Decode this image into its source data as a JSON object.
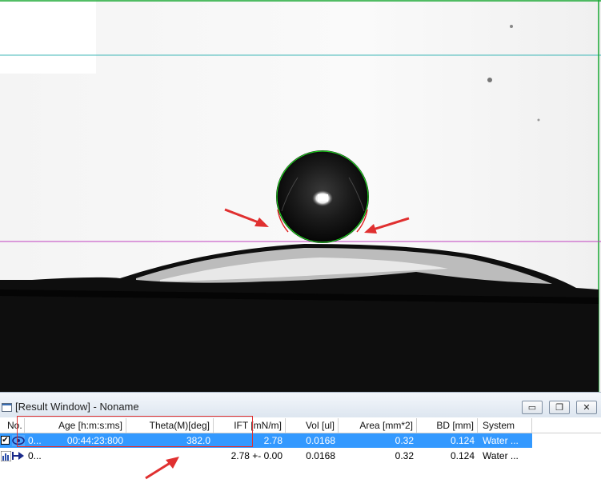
{
  "window": {
    "title": "[Result Window] - Noname",
    "minimize_label": "▭",
    "restore_label": "❐",
    "close_label": "✕"
  },
  "table": {
    "columns": [
      "No.",
      "Age [h:m:s:ms]",
      "Theta(M)[deg]",
      "IFT [mN/m]",
      "Vol [ul]",
      "Area [mm*2]",
      "BD [mm]",
      "System"
    ],
    "rows": [
      {
        "no": "0...",
        "age": "00:44:23:800",
        "theta": "382.0",
        "ift": "2.78",
        "vol": "0.0168",
        "area": "0.32",
        "bd": "0.124",
        "system": "Water ...",
        "selected": true,
        "checked": true
      },
      {
        "no": "0...",
        "age": "",
        "theta": "",
        "ift": "2.78 +- 0.00",
        "vol": "0.0168",
        "area": "0.32",
        "bd": "0.124",
        "system": "Water ...",
        "selected": false,
        "checked": false
      }
    ]
  },
  "colors": {
    "selection": "#3399ff",
    "annotation_red": "#e03030",
    "baseline_magenta": "#c040c0",
    "top_line_green": "#19a832",
    "top_line_cyan": "#3fb7b7",
    "contour_green": "#20d020"
  }
}
